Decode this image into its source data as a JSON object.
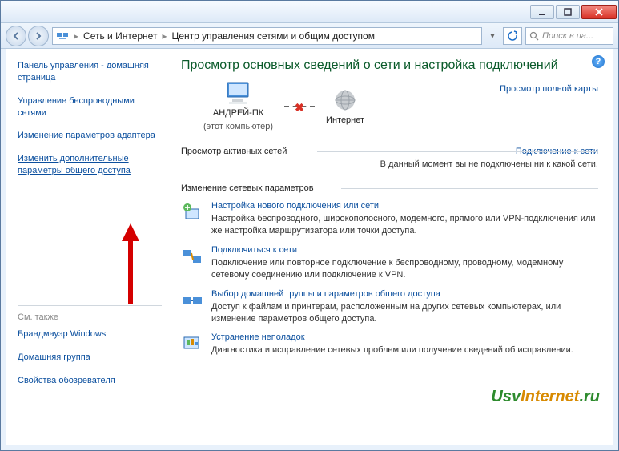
{
  "breadcrumb": {
    "item1": "Сеть и Интернет",
    "item2": "Центр управления сетями и общим доступом"
  },
  "search": {
    "placeholder": "Поиск в па..."
  },
  "sidebar": {
    "items": [
      "Панель управления - домашняя страница",
      "Управление беспроводными сетями",
      "Изменение параметров адаптера",
      "Изменить дополнительные параметры общего доступа"
    ],
    "see_also_header": "См. также",
    "see_also": [
      "Брандмауэр Windows",
      "Домашняя группа",
      "Свойства обозревателя"
    ]
  },
  "main": {
    "title": "Просмотр основных сведений о сети и настройка подключений",
    "full_map": "Просмотр полной карты",
    "node_pc": "АНДРЕЙ-ПК",
    "node_pc_sub": "(этот компьютер)",
    "node_internet": "Интернет",
    "active_nets_title": "Просмотр активных сетей",
    "connect_link": "Подключение к сети",
    "no_connection": "В данный момент вы не подключены ни к какой сети.",
    "change_params_title": "Изменение сетевых параметров",
    "tasks": [
      {
        "link": "Настройка нового подключения или сети",
        "desc": "Настройка беспроводного, широкополосного, модемного, прямого или VPN-подключения или же настройка маршрутизатора или точки доступа."
      },
      {
        "link": "Подключиться к сети",
        "desc": "Подключение или повторное подключение к беспроводному, проводному, модемному сетевому соединению или подключение к VPN."
      },
      {
        "link": "Выбор домашней группы и параметров общего доступа",
        "desc": "Доступ к файлам и принтерам, расположенным на других сетевых компьютерах, или изменение параметров общего доступа."
      },
      {
        "link": "Устранение неполадок",
        "desc": "Диагностика и исправление сетевых проблем или получение сведений об исправлении."
      }
    ]
  },
  "watermark": "UsvInternet.ru"
}
